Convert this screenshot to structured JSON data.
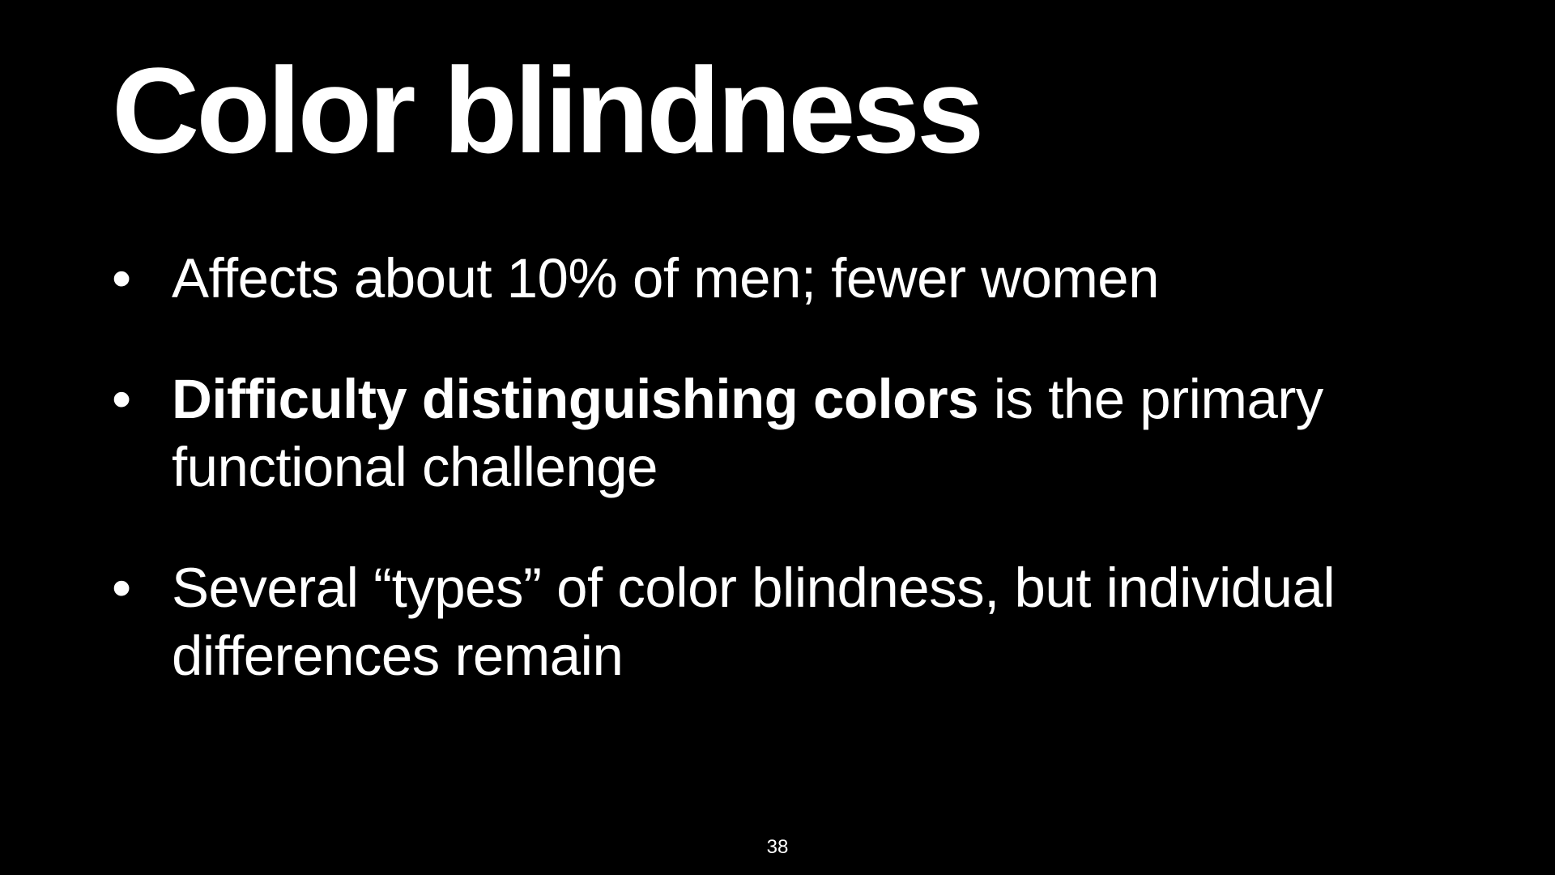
{
  "slide": {
    "title": "Color blindness",
    "bullet_marker": "•",
    "bullets": [
      {
        "bold": "",
        "text": "Affects about 10% of men; fewer women"
      },
      {
        "bold": "Difficulty distinguishing colors",
        "text": " is the primary functional challenge"
      },
      {
        "bold": "",
        "text": "Several “types” of color blindness, but individual differences remain"
      }
    ],
    "page_number": "38"
  },
  "colors": {
    "background": "#000000",
    "text": "#ffffff"
  }
}
